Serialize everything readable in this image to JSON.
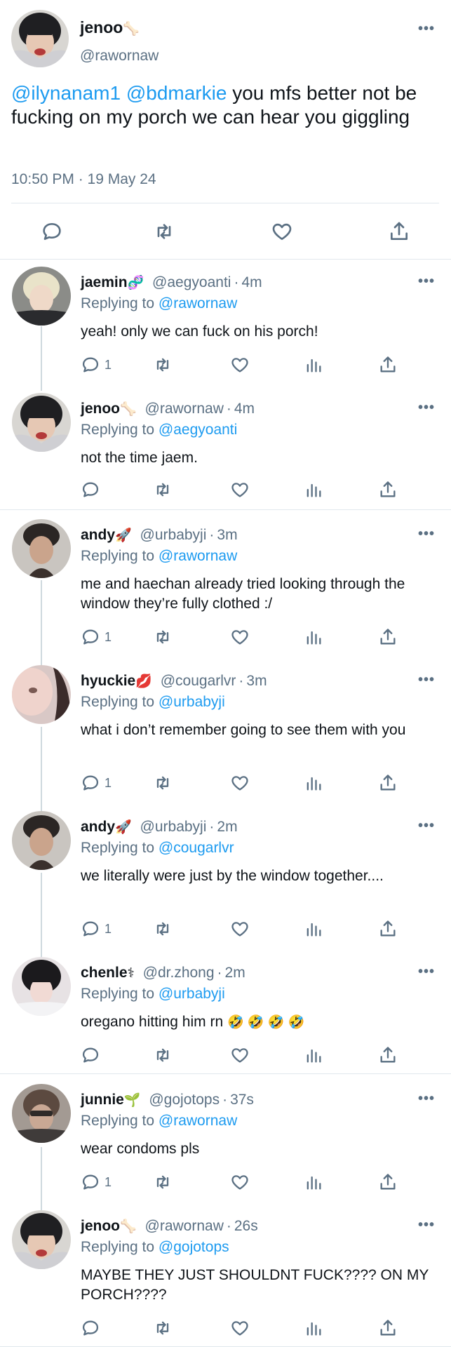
{
  "main_tweet": {
    "name": "jenoo",
    "name_emoji": "🦴",
    "handle": "@rawornaw",
    "mention1": "@ilynanam1",
    "mention2": "@bdmarkie",
    "text": " you mfs better not be fucking on my porch we can hear you giggling",
    "timestamp": "10:50 PM · 19 May 24",
    "more": "•••"
  },
  "replies": [
    {
      "name": "jaemin",
      "emoji": "🧬",
      "handle": "@aegyoanti",
      "time": "4m",
      "replying_label": "Replying to",
      "replying_to": "@rawornaw",
      "text": "yeah! only we can fuck on his porch!",
      "reply_count": "1"
    },
    {
      "name": "jenoo",
      "emoji": "🦴",
      "handle": "@rawornaw",
      "time": "4m",
      "replying_label": "Replying to",
      "replying_to": "@aegyoanti",
      "text": "not the time jaem.",
      "reply_count": ""
    },
    {
      "name": "andy",
      "emoji": "🚀",
      "handle": "@urbabyji",
      "time": "3m",
      "replying_label": "Replying to",
      "replying_to": "@rawornaw",
      "text": "me and haechan already tried looking through the window they’re fully clothed :/",
      "reply_count": "1"
    },
    {
      "name": "hyuckie",
      "emoji": "💋",
      "handle": "@cougarlvr",
      "time": "3m",
      "replying_label": "Replying to",
      "replying_to": "@urbabyji",
      "text": "what i don’t remember going to see them with you",
      "reply_count": "1"
    },
    {
      "name": "andy",
      "emoji": "🚀",
      "handle": "@urbabyji",
      "time": "2m",
      "replying_label": "Replying to",
      "replying_to": "@cougarlvr",
      "text": "we literally were just by the window together....",
      "reply_count": "1"
    },
    {
      "name": "chenle",
      "emoji": "⚕",
      "handle": "@dr.zhong",
      "time": "2m",
      "replying_label": "Replying to",
      "replying_to": "@urbabyji",
      "text": "oregano hitting him rn",
      "text_emoji": "🤣 🤣 🤣 🤣",
      "reply_count": ""
    },
    {
      "name": "junnie",
      "emoji": "🌱",
      "handle": "@gojotops",
      "time": "37s",
      "replying_label": "Replying to",
      "replying_to": "@rawornaw",
      "text": "wear condoms pls",
      "reply_count": "1"
    },
    {
      "name": "jenoo",
      "emoji": "🦴",
      "handle": "@rawornaw",
      "time": "26s",
      "replying_label": "Replying to",
      "replying_to": "@gojotops",
      "text": "MAYBE THEY JUST SHOULDNT FUCK???? ON MY PORCH????",
      "reply_count": ""
    }
  ],
  "colors": {
    "accent": "#1d9bf0",
    "secondary_text": "#5b7083",
    "divider": "#e1e8ed"
  }
}
